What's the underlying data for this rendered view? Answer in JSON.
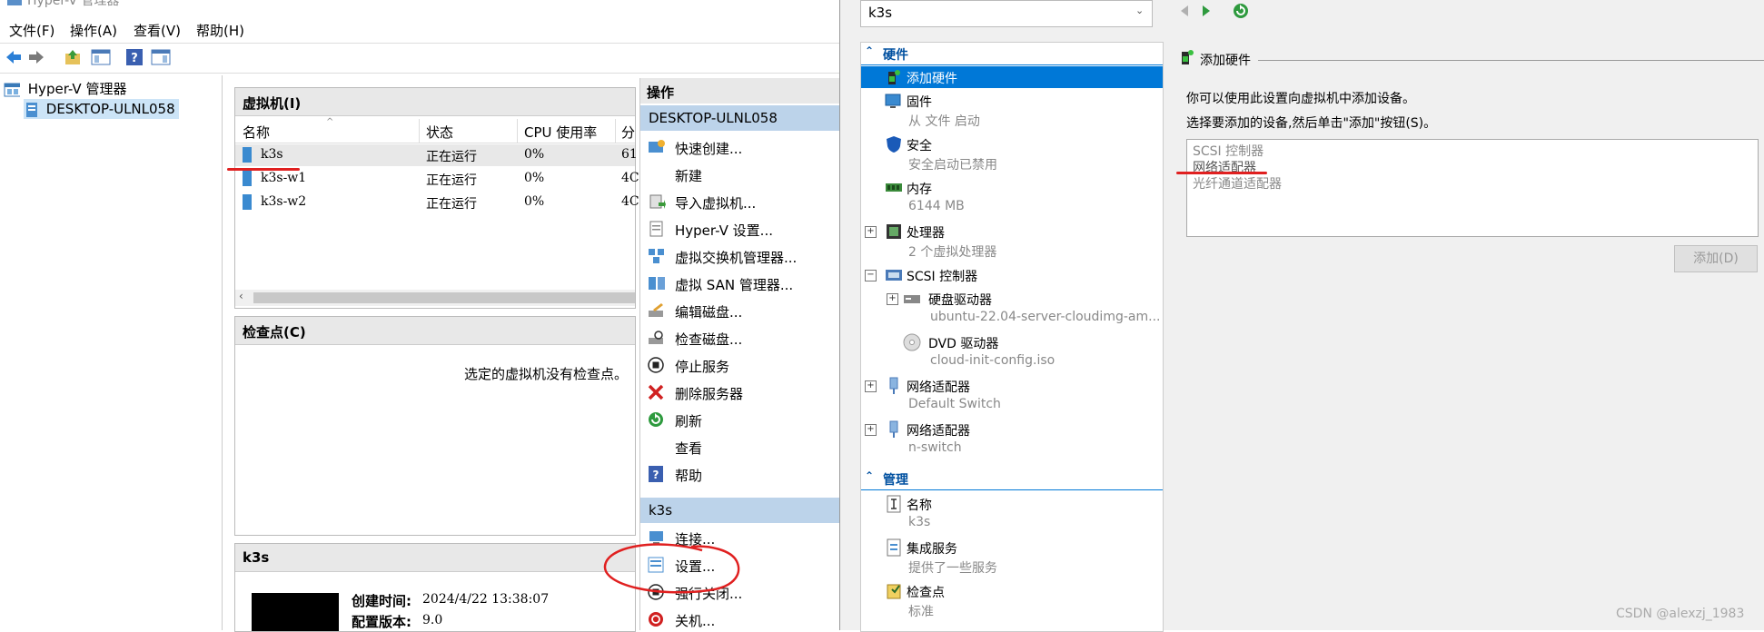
{
  "app": {
    "title": "Hyper-V 管理器"
  },
  "menu": [
    "文件(F)",
    "操作(A)",
    "查看(V)",
    "帮助(H)"
  ],
  "tree": {
    "root": "Hyper-V 管理器",
    "host": "DESKTOP-ULNL058"
  },
  "vm_panel": {
    "title": "虚拟机(I)",
    "columns": [
      "名称",
      "状态",
      "CPU 使用率",
      "分"
    ],
    "rows": [
      {
        "name": "k3s",
        "state": "正在运行",
        "cpu": "0%",
        "mem": "61"
      },
      {
        "name": "k3s-w1",
        "state": "正在运行",
        "cpu": "0%",
        "mem": "4C"
      },
      {
        "name": "k3s-w2",
        "state": "正在运行",
        "cpu": "0%",
        "mem": "4C"
      }
    ]
  },
  "checkpoint_panel": {
    "title": "检查点(C)",
    "empty_msg": "选定的虚拟机没有检查点。"
  },
  "details_panel": {
    "title": "k3s",
    "created_label": "创建时间:",
    "created_value": "2024/4/22 13:38:07",
    "config_label": "配置版本:",
    "config_value": "9.0"
  },
  "actions": {
    "title": "操作",
    "host_header": "DESKTOP-ULNL058",
    "host_items": [
      "快速创建...",
      "新建",
      "导入虚拟机...",
      "Hyper-V 设置...",
      "虚拟交换机管理器...",
      "虚拟 SAN 管理器...",
      "编辑磁盘...",
      "检查磁盘...",
      "停止服务",
      "删除服务器",
      "刷新",
      "查看",
      "帮助"
    ],
    "vm_header": "k3s",
    "vm_items": [
      "连接...",
      "设置...",
      "强行关闭...",
      "关机..."
    ]
  },
  "settings": {
    "vm_select": "k3s",
    "hardware_header": "硬件",
    "hw_items": [
      {
        "label": "添加硬件",
        "sub": ""
      },
      {
        "label": "固件",
        "sub": "从 文件 启动"
      },
      {
        "label": "安全",
        "sub": "安全启动已禁用"
      },
      {
        "label": "内存",
        "sub": "6144 MB"
      },
      {
        "label": "处理器",
        "sub": "2 个虚拟处理器"
      },
      {
        "label": "SCSI 控制器",
        "sub": ""
      },
      {
        "label": "硬盘驱动器",
        "sub": "ubuntu-22.04-server-cloudimg-am..."
      },
      {
        "label": "DVD 驱动器",
        "sub": "cloud-init-config.iso"
      },
      {
        "label": "网络适配器",
        "sub": "Default Switch"
      },
      {
        "label": "网络适配器",
        "sub": "n-switch"
      }
    ],
    "management_header": "管理",
    "mgmt_items": [
      {
        "label": "名称",
        "sub": "k3s"
      },
      {
        "label": "集成服务",
        "sub": "提供了一些服务"
      },
      {
        "label": "检查点",
        "sub": "标准"
      }
    ],
    "add_hw": {
      "title": "添加硬件",
      "desc1": "你可以使用此设置向虚拟机中添加设备。",
      "desc2": "选择要添加的设备,然后单击\"添加\"按钮(S)。",
      "options": [
        "SCSI 控制器",
        "网络适配器",
        "光纤通道适配器"
      ],
      "add_button": "添加(D)"
    }
  },
  "watermark": "CSDN @alexzj_1983",
  "colors": {
    "accent": "#0078d7",
    "header": "#bcd3ea",
    "annotation": "#e02020"
  }
}
